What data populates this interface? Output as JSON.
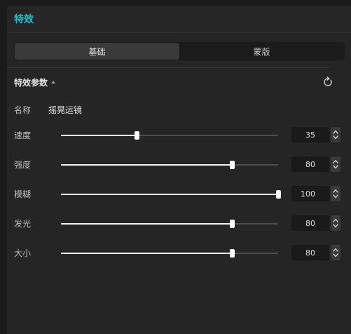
{
  "panel": {
    "title": "特效"
  },
  "tabs": [
    {
      "label": "基础",
      "active": true
    },
    {
      "label": "蒙版",
      "active": false
    }
  ],
  "section": {
    "title": "特效参数",
    "reset_icon": "reset-icon",
    "collapse_icon": "caret-up-icon"
  },
  "effect_name": {
    "label": "名称",
    "value": "摇晃运镜"
  },
  "params": [
    {
      "key": "speed",
      "label": "速度",
      "value": "35",
      "fraction": 0.35
    },
    {
      "key": "strength",
      "label": "强度",
      "value": "80",
      "fraction": 0.79
    },
    {
      "key": "blur",
      "label": "模糊",
      "value": "100",
      "fraction": 1.0
    },
    {
      "key": "glow",
      "label": "发光",
      "value": "80",
      "fraction": 0.79
    },
    {
      "key": "size",
      "label": "大小",
      "value": "80",
      "fraction": 0.79
    }
  ],
  "colors": {
    "accent": "#19c4cc",
    "panel_bg": "#252525",
    "slider_fill": "#f2f2f2",
    "slider_track": "#4d4d4d"
  }
}
